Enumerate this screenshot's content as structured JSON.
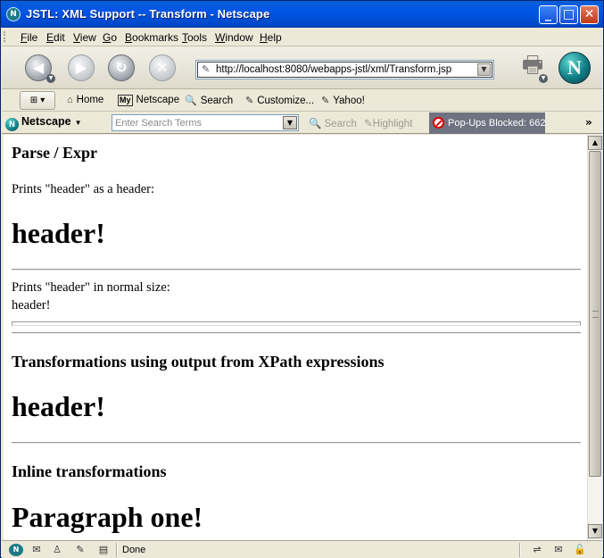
{
  "window": {
    "title": "JSTL: XML Support -- Transform - Netscape",
    "app_icon": "netscape-n-icon",
    "controls": [
      "minimize-icon",
      "maximize-icon",
      "close-icon"
    ]
  },
  "menubar": {
    "items": [
      {
        "key": "F",
        "rest": "ile"
      },
      {
        "key": "E",
        "rest": "dit"
      },
      {
        "key": "V",
        "rest": "iew"
      },
      {
        "key": "G",
        "rest": "o"
      },
      {
        "key": "B",
        "rest": "ookmarks"
      },
      {
        "key": "T",
        "rest": "ools"
      },
      {
        "key": "W",
        "rest": "indow"
      },
      {
        "key": "H",
        "rest": "elp"
      }
    ]
  },
  "navbar": {
    "url": "http://localhost:8080/webapps-jstl/xml/Transform.jsp",
    "buttons": [
      "back-icon",
      "forward-icon",
      "reload-icon",
      "stop-icon"
    ]
  },
  "personal_toolbar": {
    "home": "Home",
    "my_badge": "My",
    "netscape": "Netscape",
    "search": "Search",
    "customize": "Customize...",
    "yahoo": "Yahoo!"
  },
  "search_toolbar": {
    "netscape_label": "Netscape",
    "search_placeholder": "Enter Search Terms",
    "search_button": "Search",
    "highlight_button": "Highlight",
    "popups_blocked": "Pop-Ups Blocked: 662"
  },
  "content": {
    "parse_heading": "Parse / Expr",
    "prints_header_as_header": "Prints \"header\" as a header:",
    "header_big_1": "header!",
    "prints_header_normal": "Prints \"header\" in normal size:",
    "header_normal": "header!",
    "xpath_heading": "Transformations using output from XPath expressions",
    "header_big_2": "header!",
    "inline_heading": "Inline transformations",
    "paragraph_one": "Paragraph one!"
  },
  "statusbar": {
    "status_text": "Done"
  },
  "colors": {
    "titlebar": "#0055e5",
    "chrome": "#ece9d8",
    "popup_bar": "#6f7381"
  }
}
